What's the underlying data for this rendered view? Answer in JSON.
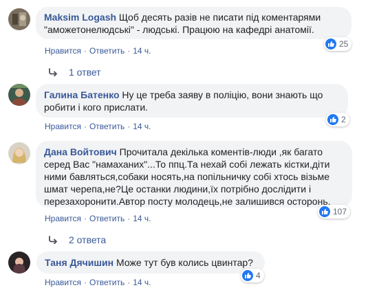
{
  "comments": [
    {
      "author": "Maksim Logash",
      "text": "Щоб десять разів не писати під коментарями \"аможетонелюдські\" - людські. Працюю на кафедрі анатомії.",
      "like": "Нравится",
      "reply": "Ответить",
      "time": "14 ч.",
      "reactions": "25"
    },
    {
      "author": "Галина Батенко",
      "text": "Ну це треба заяву в поліцію, вони знають що робити і кого прислати.",
      "like": "Нравится",
      "reply": "Ответить",
      "time": "14 ч.",
      "reactions": "2"
    },
    {
      "author": "Дана Войтович",
      "text": "Прочитала декілька коментів-люди ,як багато серед Вас \"намаханих\"...То ппц.Та нехай собі лежать кістки,діти ними бавляться,собаки носять,на попільничку собі хтось візьме шмат черепа,не?Це останки людини,їх потрібно дослідити і перезахоронити.Автор посту молодець,не залишився осторонь.",
      "like": "Нравится",
      "reply": "Ответить",
      "time": "14 ч.",
      "reactions": "107"
    },
    {
      "author": "Таня Дячишин",
      "text": "Може тут був колись цвинтар?",
      "like": "Нравится",
      "reply": "Ответить",
      "time": "14 ч.",
      "reactions": "4"
    }
  ],
  "replies": [
    "1 ответ",
    "2 ответа"
  ],
  "colors": {
    "link": "#385898",
    "bubble": "#f2f3f5",
    "like": "#2078f4",
    "meta": "#606770"
  }
}
